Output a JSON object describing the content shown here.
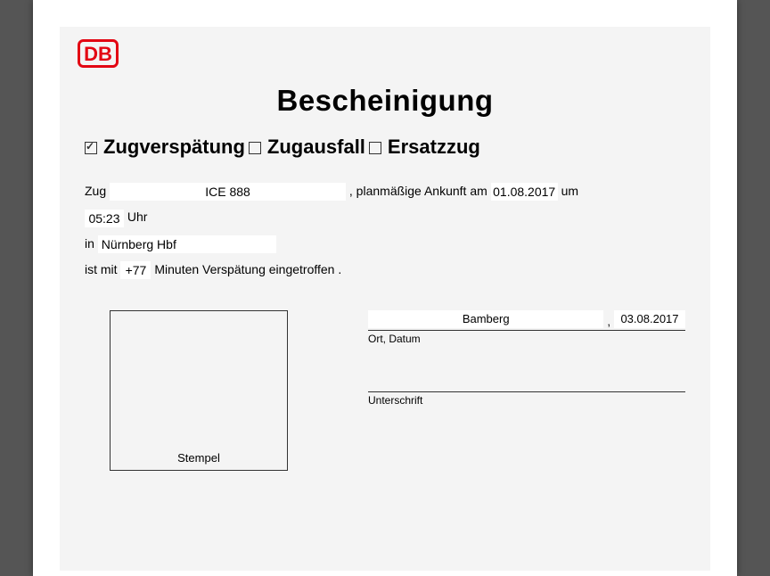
{
  "logo": {
    "text": "DB",
    "caption": "db-logo"
  },
  "title": "Bescheinigung",
  "checks": {
    "delay": {
      "label": "Zugverspätung",
      "checked": true
    },
    "cancelled": {
      "label": "Zugausfall",
      "checked": false
    },
    "replace": {
      "label": "Ersatzzug",
      "checked": false
    }
  },
  "labels": {
    "zug": "Zug",
    "plan_ankunft": ", planmäßige Ankunft am",
    "um": "um",
    "uhr": "Uhr",
    "in": "in",
    "ist_mit": "ist mit",
    "min_versp": "Minuten Verspätung eingetroffen .",
    "stempel": "Stempel",
    "ort_datum": "Ort, Datum",
    "unterschrift": "Unterschrift",
    "comma": ","
  },
  "values": {
    "zugnummer": "ICE 888",
    "ankunft_datum": "01.08.2017",
    "ankunft_zeit": "05:23",
    "station": "Nürnberg Hbf",
    "verspaetung_min": "+77",
    "sig_ort": "Bamberg",
    "sig_datum": "03.08.2017"
  }
}
